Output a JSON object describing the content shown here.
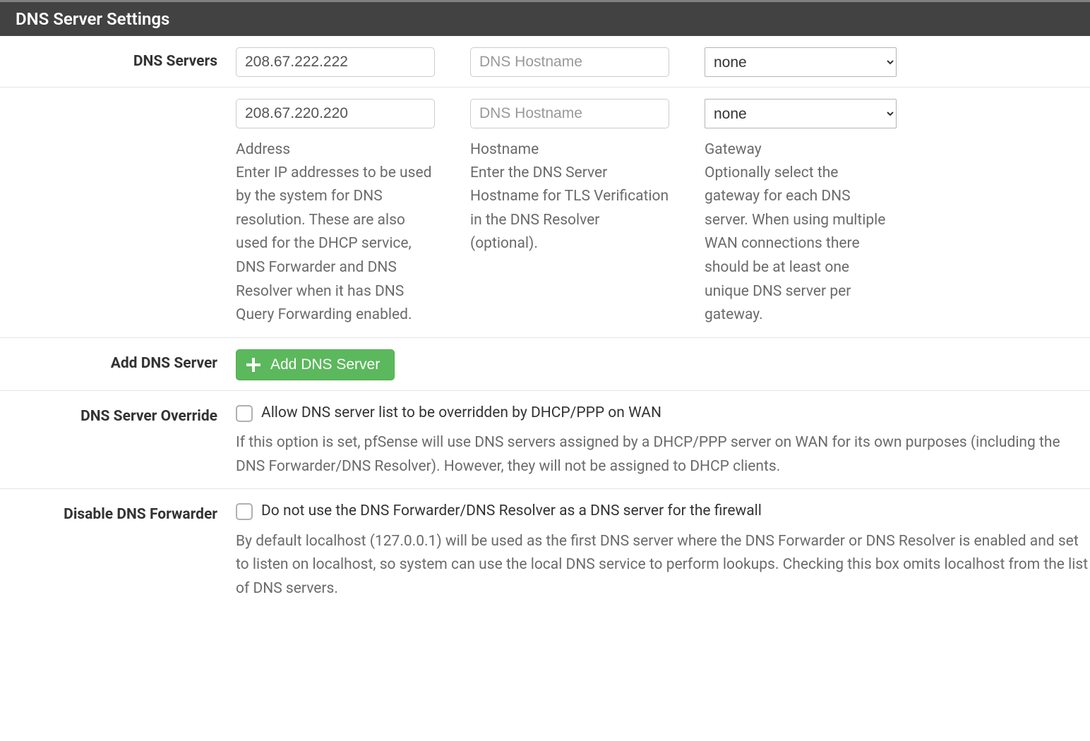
{
  "panel": {
    "title": "DNS Server Settings"
  },
  "dns_servers": {
    "label": "DNS Servers",
    "rows": [
      {
        "address": "208.67.222.222",
        "hostname": "",
        "gateway": "none"
      },
      {
        "address": "208.67.220.220",
        "hostname": "",
        "gateway": "none"
      }
    ],
    "hostname_placeholder": "DNS Hostname",
    "help": {
      "address_title": "Address",
      "address_text": "Enter IP addresses to be used by the system for DNS resolution. These are also used for the DHCP service, DNS Forwarder and DNS Resolver when it has DNS Query Forwarding enabled.",
      "hostname_title": "Hostname",
      "hostname_text": "Enter the DNS Server Hostname for TLS Verification in the DNS Resolver (optional).",
      "gateway_title": "Gateway",
      "gateway_text": "Optionally select the gateway for each DNS server. When using multiple WAN connections there should be at least one unique DNS server per gateway."
    }
  },
  "add_dns": {
    "label": "Add DNS Server",
    "button": "Add DNS Server"
  },
  "override": {
    "label": "DNS Server Override",
    "option": "Allow DNS server list to be overridden by DHCP/PPP on WAN",
    "help": "If this option is set, pfSense will use DNS servers assigned by a DHCP/PPP server on WAN for its own purposes (including the DNS Forwarder/DNS Resolver). However, they will not be assigned to DHCP clients."
  },
  "disable_forwarder": {
    "label": "Disable DNS Forwarder",
    "option": "Do not use the DNS Forwarder/DNS Resolver as a DNS server for the firewall",
    "help": "By default localhost (127.0.0.1) will be used as the first DNS server where the DNS Forwarder or DNS Resolver is enabled and set to listen on localhost, so system can use the local DNS service to perform lookups. Checking this box omits localhost from the list of DNS servers."
  }
}
